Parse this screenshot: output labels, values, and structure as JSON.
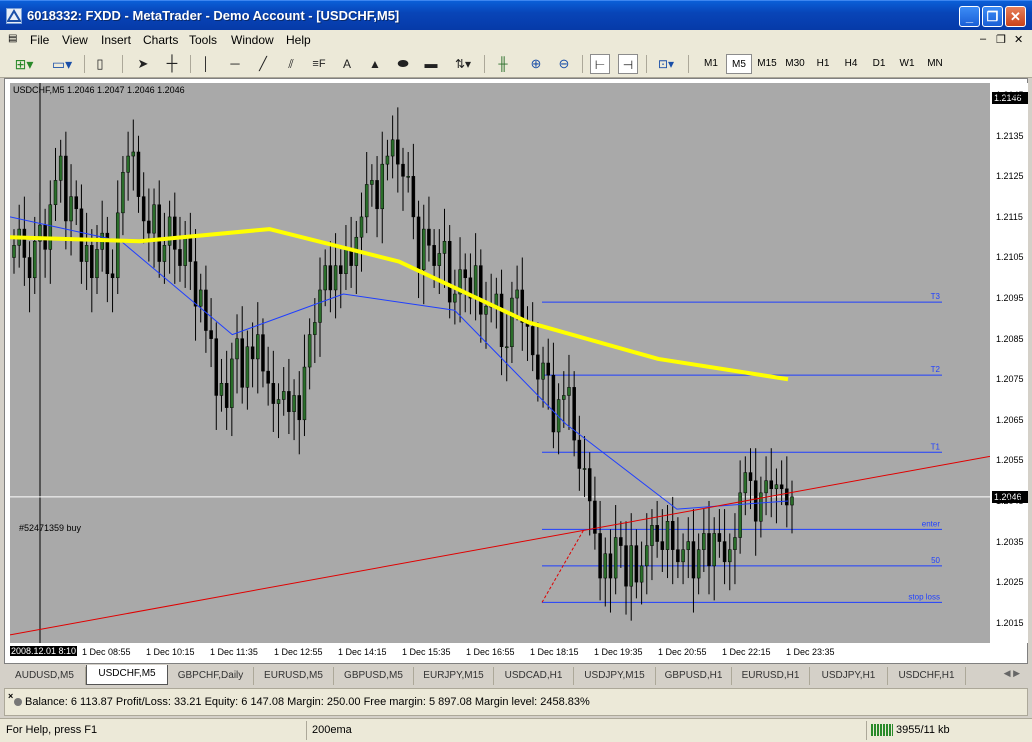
{
  "window": {
    "title": "6018332: FXDD - MetaTrader - Demo Account - [USDCHF,M5]"
  },
  "menu": [
    "File",
    "View",
    "Insert",
    "Charts",
    "Tools",
    "Window",
    "Help"
  ],
  "timeframes": [
    "M1",
    "M5",
    "M15",
    "M30",
    "H1",
    "H4",
    "D1",
    "W1",
    "MN"
  ],
  "active_timeframe": "M5",
  "chart": {
    "symbol_info": "USDCHF,M5  1.2046 1.2047 1.2046 1.2046",
    "order_label": "#52471359 buy",
    "current_price": "1.2046",
    "top_price": "1.2146",
    "price_ticks": [
      "1.2145",
      "1.2135",
      "1.2125",
      "1.2115",
      "1.2105",
      "1.2095",
      "1.2085",
      "1.2075",
      "1.2065",
      "1.2055",
      "1.2045",
      "1.2035",
      "1.2025",
      "1.2015"
    ],
    "first_time": "2008.12.01 8:10",
    "time_ticks": [
      "1 Dec 08:55",
      "1 Dec 10:15",
      "1 Dec 11:35",
      "1 Dec 12:55",
      "1 Dec 14:15",
      "1 Dec 15:35",
      "1 Dec 16:55",
      "1 Dec 18:15",
      "1 Dec 19:35",
      "1 Dec 20:55",
      "1 Dec 22:15",
      "1 Dec 23:35"
    ],
    "levels": [
      {
        "label": "T3",
        "price": 1.2094
      },
      {
        "label": "T2",
        "price": 1.2076
      },
      {
        "label": "T1",
        "price": 1.2057
      },
      {
        "label": "enter",
        "price": 1.2038
      },
      {
        "label": "50",
        "price": 1.2029
      },
      {
        "label": "stop loss",
        "price": 1.202
      }
    ],
    "colors": {
      "background": "#a9a9a9",
      "bull": "#2a6e2a",
      "bear": "#000000",
      "ema200": "#ffff00",
      "ma": "#1f3fff",
      "trendline": "#e00000",
      "levels": "#1f3fff"
    }
  },
  "chart_data": {
    "type": "candlestick",
    "ylim": [
      1.201,
      1.2148
    ],
    "close": [
      1.2108,
      1.2112,
      1.2105,
      1.21,
      1.2109,
      1.2113,
      1.2107,
      1.2118,
      1.2124,
      1.213,
      1.2114,
      1.212,
      1.2117,
      1.2104,
      1.2108,
      1.21,
      1.2107,
      1.2111,
      1.2101,
      1.21,
      1.2116,
      1.2126,
      1.213,
      1.2131,
      1.212,
      1.2114,
      1.2111,
      1.2118,
      1.2104,
      1.2108,
      1.2115,
      1.2107,
      1.2103,
      1.211,
      1.2104,
      1.2093,
      1.2097,
      1.2087,
      1.2085,
      1.2071,
      1.2074,
      1.2068,
      1.208,
      1.2085,
      1.2073,
      1.2083,
      1.208,
      1.2086,
      1.2077,
      1.2074,
      1.2069,
      1.207,
      1.2072,
      1.2067,
      1.2071,
      1.2065,
      1.2078,
      1.2086,
      1.2089,
      1.2097,
      1.2103,
      1.2097,
      1.2103,
      1.2101,
      1.2107,
      1.2103,
      1.211,
      1.2115,
      1.2123,
      1.2124,
      1.2117,
      1.2128,
      1.213,
      1.2134,
      1.2128,
      1.2125,
      1.2125,
      1.2115,
      1.2102,
      1.2112,
      1.2108,
      1.2103,
      1.2106,
      1.2109,
      1.2094,
      1.2096,
      1.2102,
      1.21,
      1.2095,
      1.2103,
      1.2091,
      1.2093,
      1.2093,
      1.2096,
      1.2083,
      1.2083,
      1.2095,
      1.2097,
      1.2089,
      1.2088,
      1.2081,
      1.2075,
      1.2079,
      1.2076,
      1.2062,
      1.207,
      1.2071,
      1.2073,
      1.206,
      1.2053,
      1.2053,
      1.2045,
      1.2037,
      1.2026,
      1.2032,
      1.2026,
      1.2036,
      1.2034,
      1.2024,
      1.2034,
      1.2025,
      1.2029,
      1.2034,
      1.2039,
      1.2035,
      1.2033,
      1.204,
      1.2033,
      1.203,
      1.2033,
      1.2035,
      1.2026,
      1.2033,
      1.2037,
      1.2029,
      1.2037,
      1.2035,
      1.203,
      1.2033,
      1.2036,
      1.2047,
      1.2052,
      1.205,
      1.204,
      1.2047,
      1.205,
      1.2048,
      1.2049,
      1.2048,
      1.2044,
      1.2046
    ],
    "ema200": [
      1.211,
      1.2109,
      1.2112,
      1.2104,
      1.2089,
      1.208,
      1.2075
    ],
    "ma": [
      1.2115,
      1.2109,
      1.2086,
      1.2096,
      1.2092,
      1.2064,
      1.2043,
      1.2045
    ],
    "trendline": [
      1.2012,
      1.2056
    ]
  },
  "tabs": [
    "AUDUSD,M5",
    "USDCHF,M5",
    "GBPCHF,Daily",
    "EURUSD,M5",
    "GBPUSD,M5",
    "EURJPY,M15",
    "USDCAD,H1",
    "USDJPY,M15",
    "GBPUSD,H1",
    "EURUSD,H1",
    "USDJPY,H1",
    "USDCHF,H1"
  ],
  "active_tab": "USDCHF,M5",
  "terminal": {
    "summary": "Balance: 6 113.87  Profit/Loss: 33.21  Equity: 6 147.08  Margin: 250.00  Free margin: 5 897.08  Margin level: 2458.83%"
  },
  "status": {
    "help": "For Help, press F1",
    "profile": "200ema",
    "connection": "3955/11 kb"
  }
}
